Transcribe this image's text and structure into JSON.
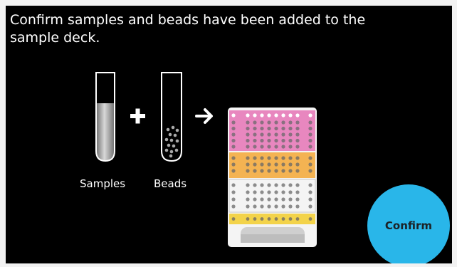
{
  "instruction": "Confirm samples and beads have been added to the sample deck.",
  "labels": {
    "samples": "Samples",
    "beads": "Beads"
  },
  "confirm_button": {
    "label": "Confirm"
  },
  "icons": [
    "sample-tube-icon",
    "plus-icon",
    "bead-tube-icon",
    "arrow-right-icon",
    "sample-deck-icon"
  ],
  "colors": {
    "background": "#000000",
    "text": "#ffffff",
    "confirm_button": "#29b6e9",
    "deck_pink": "#e887bf",
    "deck_orange": "#f4b352",
    "deck_white": "#f4f4f4",
    "deck_yellow": "#f3d34a"
  }
}
